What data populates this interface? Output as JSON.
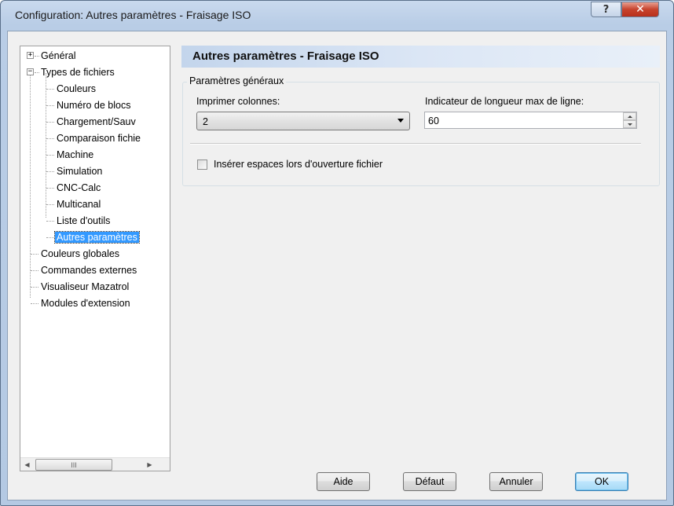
{
  "window": {
    "title": "Configuration: Autres paramètres - Fraisage ISO",
    "help_glyph": "?",
    "close_glyph": "✕"
  },
  "tree": {
    "items": [
      {
        "label": "Général",
        "expander": "+"
      },
      {
        "label": "Types de fichiers",
        "expander": "−"
      },
      {
        "label": "Couleurs"
      },
      {
        "label": "Numéro de blocs"
      },
      {
        "label": "Chargement/Sauv"
      },
      {
        "label": "Comparaison fichie"
      },
      {
        "label": "Machine"
      },
      {
        "label": "Simulation"
      },
      {
        "label": "CNC-Calc"
      },
      {
        "label": "Multicanal"
      },
      {
        "label": "Liste d'outils"
      },
      {
        "label": "Autres paramètres",
        "selected": true
      },
      {
        "label": "Couleurs globales"
      },
      {
        "label": "Commandes externes"
      },
      {
        "label": "Visualiseur Mazatrol"
      },
      {
        "label": "Modules d'extension"
      }
    ],
    "scroll_left": "◀",
    "scroll_right": "▶",
    "scroll_grip": "III"
  },
  "panel": {
    "header": "Autres paramètres - Fraisage ISO",
    "group_title": "Paramètres généraux",
    "print_columns_label": "Imprimer colonnes:",
    "print_columns_value": "2",
    "max_line_label": "Indicateur de longueur max de ligne:",
    "max_line_value": "60",
    "insert_spaces_label": "Insérer espaces lors d'ouverture fichier",
    "insert_spaces_checked": false
  },
  "buttons": {
    "help": "Aide",
    "default": "Défaut",
    "cancel": "Annuler",
    "ok": "OK"
  }
}
